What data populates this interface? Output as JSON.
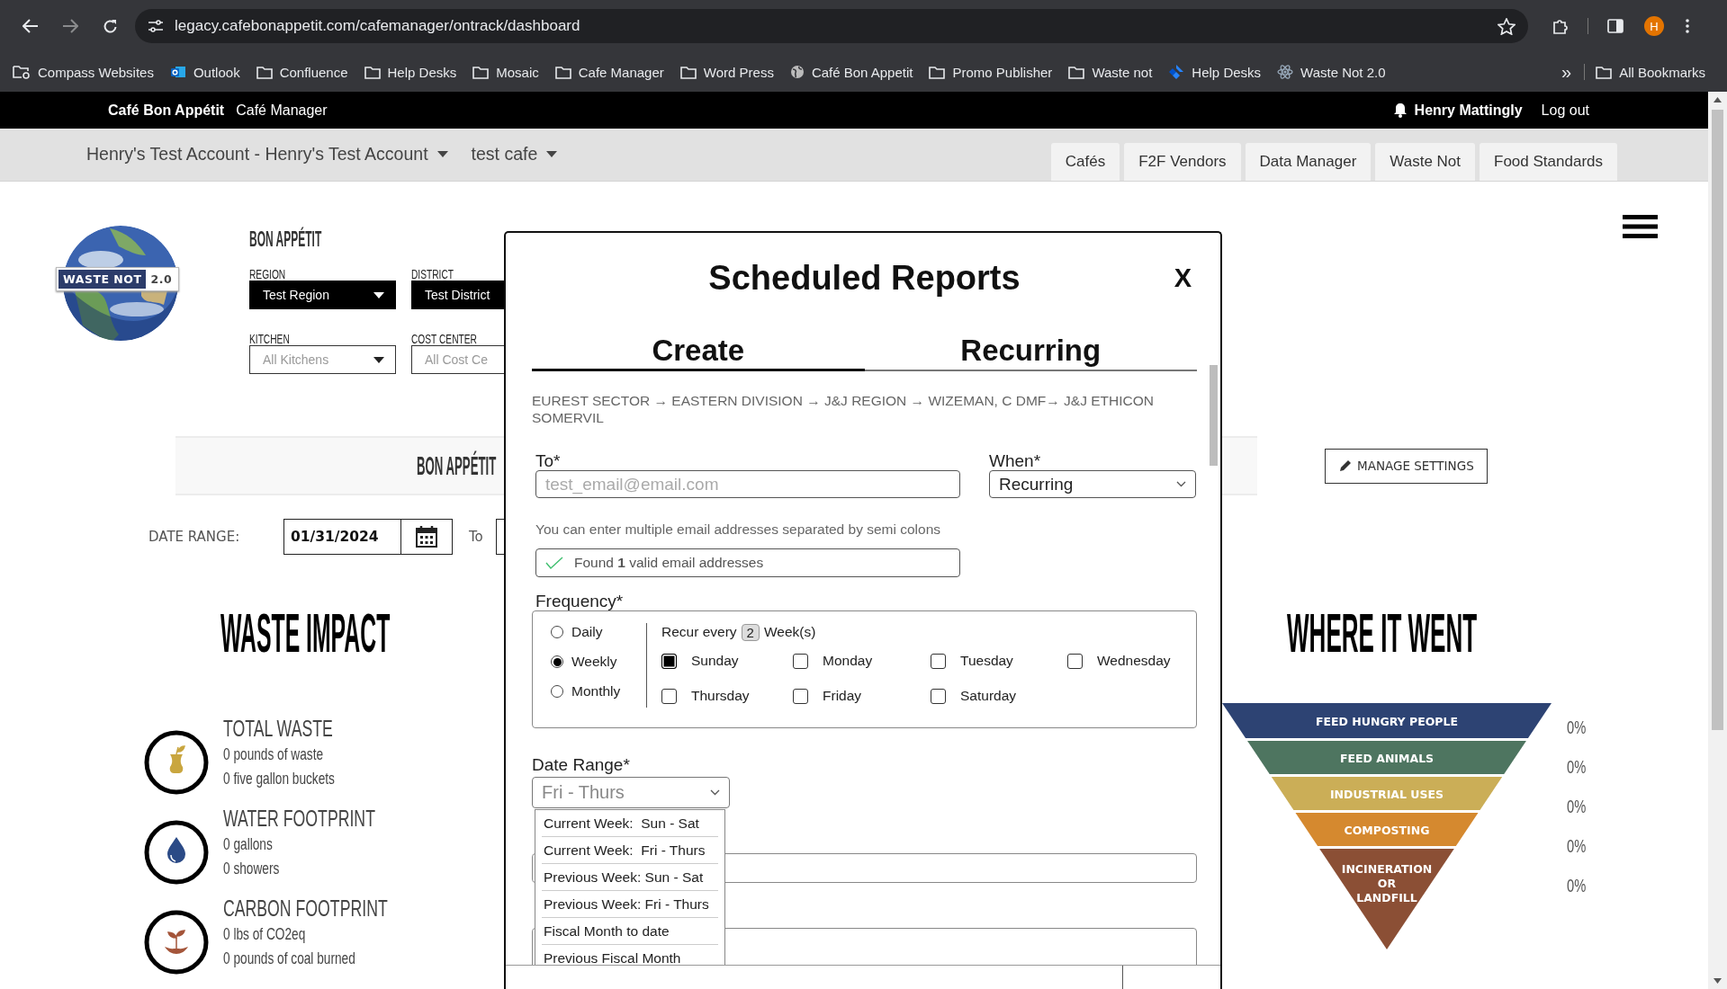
{
  "browser": {
    "url": "legacy.cafebonappetit.com/cafemanager/ontrack/dashboard",
    "avatar": "H",
    "bookmarks": [
      {
        "label": "Compass Websites",
        "kind": "compass"
      },
      {
        "label": "Outlook",
        "kind": "outlook"
      },
      {
        "label": "Confluence",
        "kind": "folder"
      },
      {
        "label": "Help Desks",
        "kind": "folder"
      },
      {
        "label": "Mosaic",
        "kind": "folder"
      },
      {
        "label": "Cafe Manager",
        "kind": "folder"
      },
      {
        "label": "Word Press",
        "kind": "folder"
      },
      {
        "label": "Café Bon Appetit",
        "kind": "globe"
      },
      {
        "label": "Promo Publisher",
        "kind": "folder"
      },
      {
        "label": "Waste not",
        "kind": "folder"
      },
      {
        "label": "Help Desks",
        "kind": "jira"
      },
      {
        "label": "Waste Not 2.0",
        "kind": "atom"
      }
    ],
    "overflow": "»",
    "all_bookmarks": "All Bookmarks"
  },
  "site_header": {
    "brand": "Café Bon Appétit",
    "app": "Café Manager",
    "user": "Henry Mattingly",
    "logout": "Log out"
  },
  "nav": {
    "account": "Henry's Test Account - Henry's Test Account",
    "cafe": "test cafe",
    "tabs": [
      "Cafés",
      "F2F Vendors",
      "Data Manager",
      "Waste Not",
      "Food Standards"
    ]
  },
  "dashboard": {
    "logo": {
      "badge": "WASTE NOT",
      "version": "2.0"
    },
    "brand": "BON APPÉTIT",
    "filters": [
      {
        "label": "REGION",
        "value": "Test Region",
        "kind": "dark"
      },
      {
        "label": "DISTRICT",
        "value": "Test District",
        "kind": "dark"
      },
      {
        "label": "KITCHEN",
        "value": "All Kitchens",
        "kind": "light"
      },
      {
        "label": "COST CENTER",
        "value": "All Cost Ce",
        "kind": "light"
      }
    ],
    "banner": "BON APPÉTIT",
    "manage_settings": "MANAGE SETTINGS",
    "date_range": {
      "label": "DATE RANGE:",
      "from": "01/31/2024",
      "to_label": "To"
    },
    "waste_impact": {
      "title": "WASTE IMPACT",
      "items": [
        {
          "kind": "waste",
          "title": "TOTAL WASTE",
          "lines": [
            "0 pounds of waste",
            "0 five gallon buckets"
          ]
        },
        {
          "kind": "water",
          "title": "WATER FOOTPRINT",
          "lines": [
            "0 gallons",
            "0 showers"
          ]
        },
        {
          "kind": "carbon",
          "title": "CARBON FOOTPRINT",
          "lines": [
            "0 lbs of CO2eq",
            "0 pounds of coal burned"
          ]
        }
      ]
    },
    "where_it_went": {
      "title": "WHERE IT WENT",
      "tiers": [
        {
          "lines": [
            "FEED HUNGRY PEOPLE"
          ],
          "color": "#2d4373",
          "percent": "0%"
        },
        {
          "lines": [
            "FEED ANIMALS"
          ],
          "color": "#4e7560",
          "percent": "0%"
        },
        {
          "lines": [
            "INDUSTRIAL USES"
          ],
          "color": "#cbae57",
          "percent": "0%"
        },
        {
          "lines": [
            "COMPOSTING"
          ],
          "color": "#d5892f",
          "percent": "0%"
        },
        {
          "lines": [
            "INCINERATION",
            "OR",
            "LANDFILL"
          ],
          "color": "#8b4f35",
          "percent": "0%"
        }
      ]
    }
  },
  "modal": {
    "title": "Scheduled Reports",
    "close": "X",
    "tabs": [
      {
        "label": "Create",
        "selected": true
      },
      {
        "label": "Recurring",
        "selected": false
      }
    ],
    "breadcrumb": "EUREST SECTOR → EASTERN DIVISION → J&J REGION → WIZEMAN, C DMF→ J&J ETHICON SOMERVIL",
    "to": {
      "label": "To*",
      "placeholder": "test_email@email.com"
    },
    "when": {
      "label": "When*",
      "value": "Recurring"
    },
    "hint": "You can enter multiple email addresses separated by semi colons",
    "validation": "Found **1** valid email addresses",
    "frequency": {
      "label": "Frequency*",
      "options": [
        {
          "label": "Daily",
          "selected": false
        },
        {
          "label": "Weekly",
          "selected": true
        },
        {
          "label": "Monthly",
          "selected": false
        }
      ],
      "recur_prefix": "Recur every",
      "recur_value": "2",
      "recur_unit": "Week(s)",
      "days": [
        {
          "label": "Sunday",
          "checked": true
        },
        {
          "label": "Monday",
          "checked": false
        },
        {
          "label": "Tuesday",
          "checked": false
        },
        {
          "label": "Wednesday",
          "checked": false
        },
        {
          "label": "Thursday",
          "checked": false
        },
        {
          "label": "Friday",
          "checked": false
        },
        {
          "label": "Saturday",
          "checked": false
        }
      ]
    },
    "date_range": {
      "label": "Date Range*",
      "value": "Fri - Thurs",
      "options": [
        "Current Week:  Sun - Sat",
        "Current Week:  Fri - Thurs",
        "Previous Week: Sun - Sat",
        "Previous Week: Fri - Thurs",
        "Fiscal Month to date",
        "Previous Fiscal Month"
      ]
    }
  }
}
